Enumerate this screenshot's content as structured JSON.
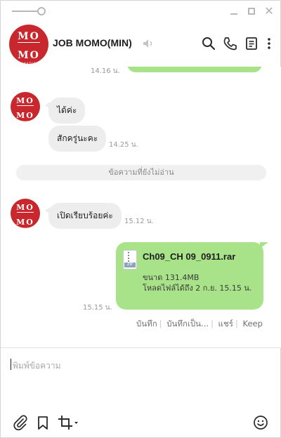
{
  "window": {
    "title": "JOB MOMO(MIN)",
    "avatar_text_top": "MO",
    "avatar_text_bottom": "MO",
    "avatar_subtext": "PARADISE"
  },
  "colors": {
    "brand_red": "#c8282d",
    "outgoing_bubble": "#a8e38a",
    "incoming_bubble": "#ededed"
  },
  "icons": {
    "mute": "speaker-mute-icon",
    "search": "search-icon",
    "call": "phone-icon",
    "notes": "notes-icon",
    "more": "more-vertical-icon",
    "attach": "paperclip-icon",
    "bookmark": "bookmark-icon",
    "crop": "crop-icon",
    "emoji": "emoji-icon"
  },
  "messages": {
    "previous_time": "14.16 น.",
    "incoming_1_text": "ได้ค่ะ",
    "incoming_2_text": "สักครู่นะคะ",
    "incoming_2_time": "14.25 น.",
    "unread_divider": "ข้อความที่ยังไม่อ่าน",
    "incoming_3_text": "เปิดเรียบร้อยค่ะ",
    "incoming_3_time": "15.12 น.",
    "file": {
      "name": "Ch09_CH 09_0911.rar",
      "size": "ขนาด 131.4MB",
      "expiry": "โหลดไฟล์ได้ถึง 2 ก.ย. 15.15 น.",
      "type_tag": "ZIP",
      "time": "15.15 น."
    },
    "file_actions": {
      "save": "บันทึก",
      "save_as": "บันทึกเป็น...",
      "share": "แชร์",
      "keep": "Keep"
    }
  },
  "composer": {
    "placeholder": "พิมพ์ข้อความ"
  }
}
